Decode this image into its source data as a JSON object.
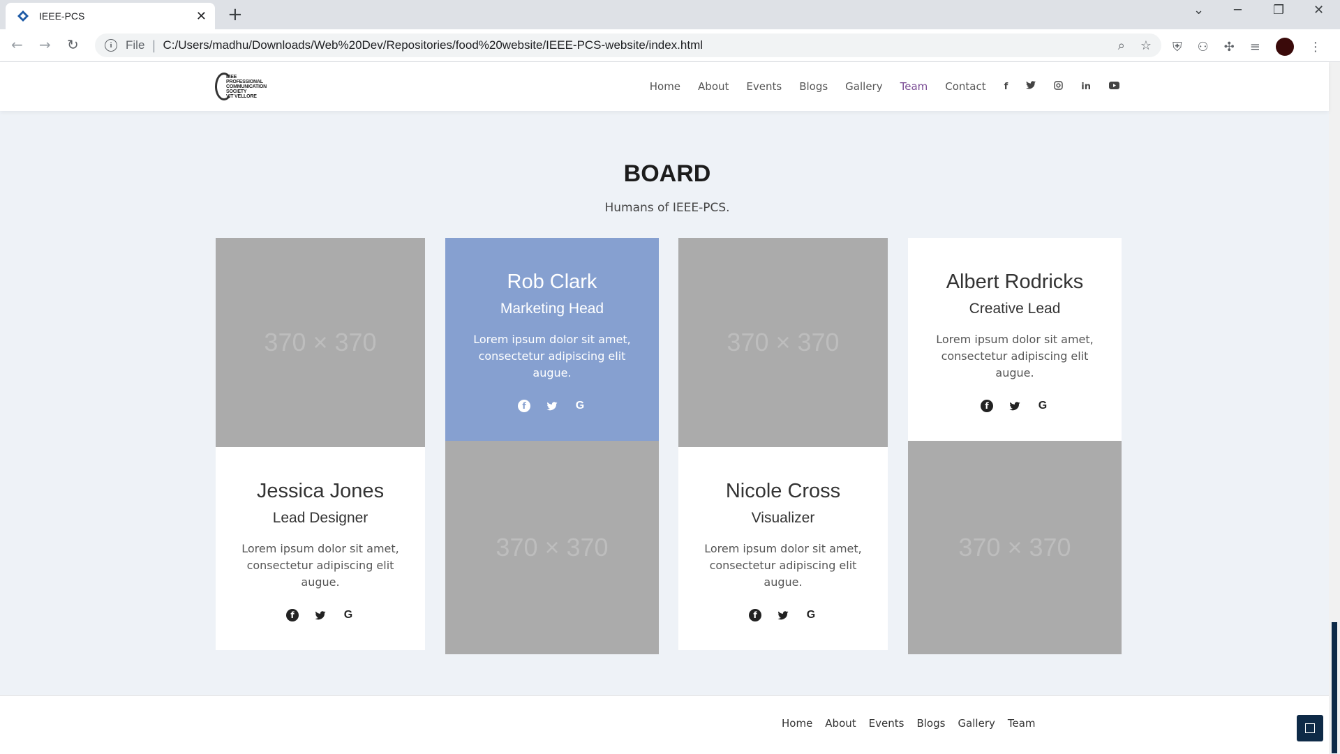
{
  "browser": {
    "tab_title": "IEEE-PCS",
    "omnibox_scheme": "File",
    "url": "C:/Users/madhu/Downloads/Web%20Dev/Repositories/food%20website/IEEE-PCS-website/index.html"
  },
  "header": {
    "logo_lines": [
      "IEEE",
      "PROFESSIONAL",
      "COMMUNICATION",
      "SOCIETY",
      "VIT VELLORE"
    ],
    "nav": [
      "Home",
      "About",
      "Events",
      "Blogs",
      "Gallery",
      "Team",
      "Contact"
    ],
    "active_nav": "Team",
    "social_icons": [
      "facebook-icon",
      "twitter-icon",
      "instagram-icon",
      "linkedin-icon",
      "youtube-icon"
    ]
  },
  "section": {
    "title": "BOARD",
    "subtitle": "Humans of IEEE-PCS."
  },
  "placeholder_text": "370 × 370",
  "members": [
    {
      "name": "Jessica Jones",
      "role": "Lead Designer",
      "desc": "Lorem ipsum dolor sit amet, consectetur adipiscing elit augue."
    },
    {
      "name": "Rob Clark",
      "role": "Marketing Head",
      "desc": "Lorem ipsum dolor sit amet, consectetur adipiscing elit augue."
    },
    {
      "name": "Nicole Cross",
      "role": "Visualizer",
      "desc": "Lorem ipsum dolor sit amet, consectetur adipiscing elit augue."
    },
    {
      "name": "Albert Rodricks",
      "role": "Creative Lead",
      "desc": "Lorem ipsum dolor sit amet, consectetur adipiscing elit augue."
    }
  ],
  "footer": {
    "nav": [
      "Home",
      "About",
      "Events",
      "Blogs",
      "Gallery",
      "Team"
    ]
  },
  "colors": {
    "accent_nav": "#7a4b94",
    "highlight_card": "#86a0d0",
    "dark_navy": "#0e2a47"
  }
}
